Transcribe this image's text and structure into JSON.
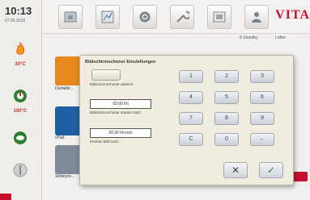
{
  "status": {
    "time": "10:13",
    "date": "07.06.2018"
  },
  "sensors": [
    {
      "icon": "flame-icon",
      "value": "30°C",
      "color": "#e8541c"
    },
    {
      "icon": "thermometer-icon",
      "value": "100°C",
      "color": "#2e7d32"
    },
    {
      "icon": "vacuum-icon",
      "value": "",
      "color": "#2e7d32"
    },
    {
      "icon": "power-icon",
      "value": "",
      "color": "#9a9a9a"
    }
  ],
  "toolbar": {
    "brand": "VITA",
    "status_right": [
      "8 Standby",
      "Lüfter"
    ]
  },
  "background_tiles": [
    {
      "label": "Dentalbr..."
    },
    {
      "label": "vPad"
    },
    {
      "label": "Sinterpro..."
    }
  ],
  "dialog": {
    "title": "Bildschirmschoner Einstellungen",
    "toggle_label": "Bildschirmschoner aktiviert",
    "field1_value": "00:00 hh",
    "field1_label": "Bildschirmschoner starten nach",
    "field2_value": "00:30 hh:mm",
    "field2_label": "Neubau Bild nach",
    "keys": [
      "1",
      "2",
      "3",
      "4",
      "5",
      "6",
      "7",
      "8",
      "9",
      "C",
      "0",
      "←"
    ],
    "cancel_symbol": "✕",
    "ok_symbol": "✓"
  },
  "colors": {
    "accent": "#c8102e",
    "ok": "#2e7d32"
  }
}
